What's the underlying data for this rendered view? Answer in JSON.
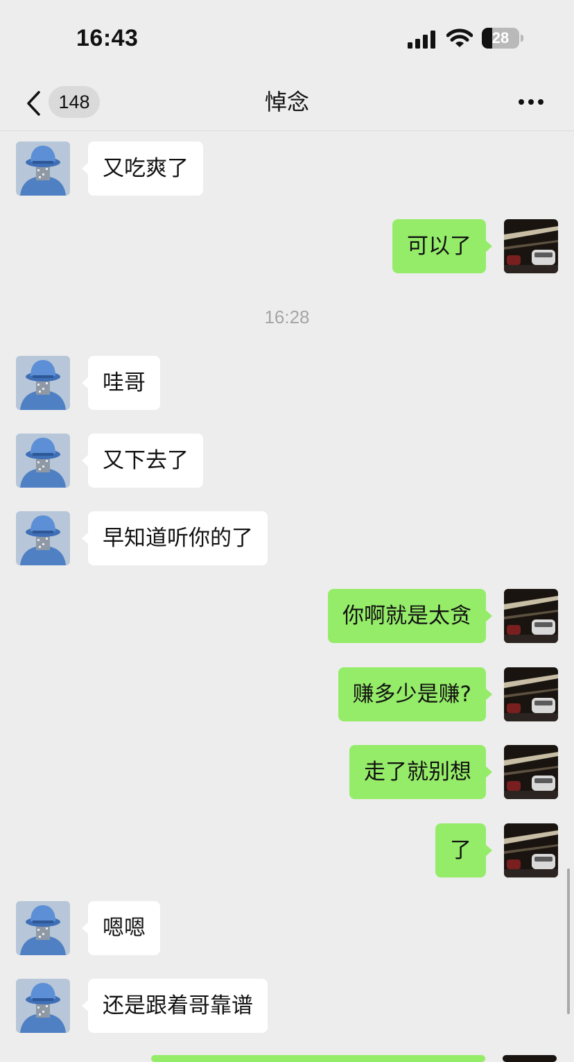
{
  "status_bar": {
    "time": "16:43",
    "battery": "28",
    "battery_level": 0.28
  },
  "nav": {
    "unread_count": "148",
    "title": "悼念"
  },
  "messages": [
    {
      "side": "left",
      "text": "又吃爽了"
    },
    {
      "side": "right",
      "text": "可以了"
    },
    {
      "side": "left",
      "text": "哇哥"
    },
    {
      "side": "left",
      "text": "又下去了"
    },
    {
      "side": "left",
      "text": "早知道听你的了"
    },
    {
      "side": "right",
      "text": "你啊就是太贪"
    },
    {
      "side": "right",
      "text": "赚多少是赚?"
    },
    {
      "side": "right",
      "text": "走了就别想"
    },
    {
      "side": "right",
      "text": "了"
    },
    {
      "side": "left",
      "text": "嗯嗯"
    },
    {
      "side": "left",
      "text": "还是跟着哥靠谱"
    }
  ],
  "timestamp": "16:28",
  "colors": {
    "background": "#ededed",
    "sent_bubble": "#95ec69",
    "received_bubble": "#ffffff"
  },
  "icons": {
    "back": "chevron-left-icon",
    "more": "more-dots-icon",
    "signal": "cellular-signal-icon",
    "wifi": "wifi-icon",
    "battery": "battery-icon"
  }
}
